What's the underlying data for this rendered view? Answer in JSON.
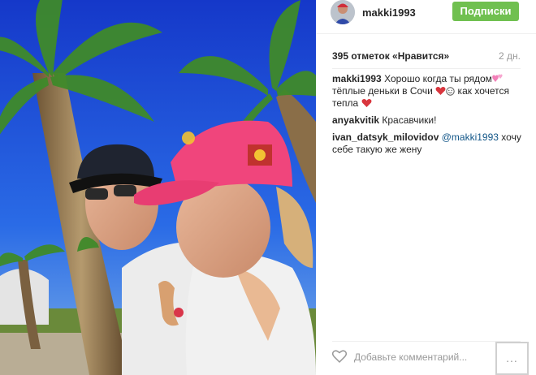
{
  "header": {
    "username": "makki1993",
    "follow_label": "Подписки",
    "follow_color": "#70c050"
  },
  "post": {
    "likes": "395 отметок «Нравится»",
    "time": "2 дн."
  },
  "comments": [
    {
      "author": "makki1993",
      "text_a": " Хорошо когда ты рядом",
      "text_b": "тёплые деньки в Сочи ",
      "text_c": " как хочется тепла "
    },
    {
      "author": "anyakvitik",
      "text": " Красавчики!"
    },
    {
      "author": "ivan_datsyk_milovidov",
      "mention": "@makki1993",
      "text": " хочу себе такую же жену"
    }
  ],
  "icons": {
    "heart": "heart-icon",
    "more": "more-options-icon",
    "emoji_heart": "red-heart-emoji",
    "emoji_pink_hearts": "pink-hearts-emoji",
    "emoji_smile": "smile-emoji"
  },
  "footer": {
    "comment_placeholder": "Добавьте комментарий...",
    "more_label": "..."
  },
  "colors": {
    "sky": "#1a4fd6",
    "cap": "#f0457c",
    "palm_green": "#3f8a2a",
    "link": "#125688"
  }
}
